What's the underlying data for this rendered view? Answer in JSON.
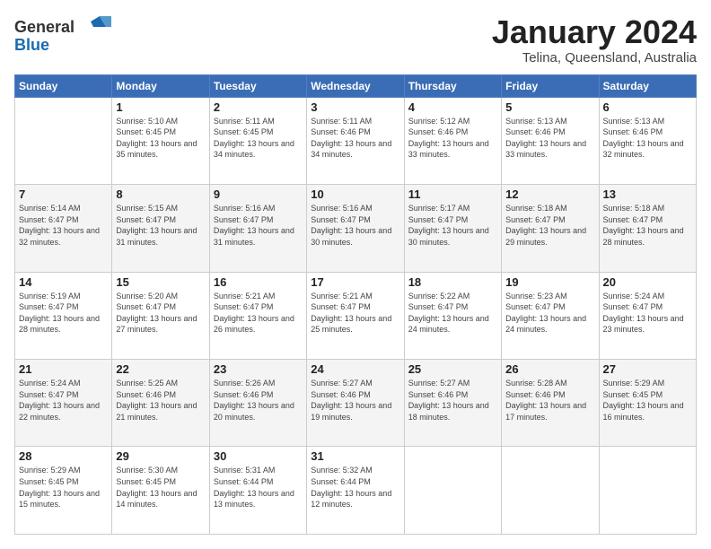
{
  "logo": {
    "general": "General",
    "blue": "Blue"
  },
  "header": {
    "month": "January 2024",
    "location": "Telina, Queensland, Australia"
  },
  "weekdays": [
    "Sunday",
    "Monday",
    "Tuesday",
    "Wednesday",
    "Thursday",
    "Friday",
    "Saturday"
  ],
  "weeks": [
    [
      {
        "day": "",
        "sunrise": "",
        "sunset": "",
        "daylight": ""
      },
      {
        "day": "1",
        "sunrise": "Sunrise: 5:10 AM",
        "sunset": "Sunset: 6:45 PM",
        "daylight": "Daylight: 13 hours and 35 minutes."
      },
      {
        "day": "2",
        "sunrise": "Sunrise: 5:11 AM",
        "sunset": "Sunset: 6:45 PM",
        "daylight": "Daylight: 13 hours and 34 minutes."
      },
      {
        "day": "3",
        "sunrise": "Sunrise: 5:11 AM",
        "sunset": "Sunset: 6:46 PM",
        "daylight": "Daylight: 13 hours and 34 minutes."
      },
      {
        "day": "4",
        "sunrise": "Sunrise: 5:12 AM",
        "sunset": "Sunset: 6:46 PM",
        "daylight": "Daylight: 13 hours and 33 minutes."
      },
      {
        "day": "5",
        "sunrise": "Sunrise: 5:13 AM",
        "sunset": "Sunset: 6:46 PM",
        "daylight": "Daylight: 13 hours and 33 minutes."
      },
      {
        "day": "6",
        "sunrise": "Sunrise: 5:13 AM",
        "sunset": "Sunset: 6:46 PM",
        "daylight": "Daylight: 13 hours and 32 minutes."
      }
    ],
    [
      {
        "day": "7",
        "sunrise": "Sunrise: 5:14 AM",
        "sunset": "Sunset: 6:47 PM",
        "daylight": "Daylight: 13 hours and 32 minutes."
      },
      {
        "day": "8",
        "sunrise": "Sunrise: 5:15 AM",
        "sunset": "Sunset: 6:47 PM",
        "daylight": "Daylight: 13 hours and 31 minutes."
      },
      {
        "day": "9",
        "sunrise": "Sunrise: 5:16 AM",
        "sunset": "Sunset: 6:47 PM",
        "daylight": "Daylight: 13 hours and 31 minutes."
      },
      {
        "day": "10",
        "sunrise": "Sunrise: 5:16 AM",
        "sunset": "Sunset: 6:47 PM",
        "daylight": "Daylight: 13 hours and 30 minutes."
      },
      {
        "day": "11",
        "sunrise": "Sunrise: 5:17 AM",
        "sunset": "Sunset: 6:47 PM",
        "daylight": "Daylight: 13 hours and 30 minutes."
      },
      {
        "day": "12",
        "sunrise": "Sunrise: 5:18 AM",
        "sunset": "Sunset: 6:47 PM",
        "daylight": "Daylight: 13 hours and 29 minutes."
      },
      {
        "day": "13",
        "sunrise": "Sunrise: 5:18 AM",
        "sunset": "Sunset: 6:47 PM",
        "daylight": "Daylight: 13 hours and 28 minutes."
      }
    ],
    [
      {
        "day": "14",
        "sunrise": "Sunrise: 5:19 AM",
        "sunset": "Sunset: 6:47 PM",
        "daylight": "Daylight: 13 hours and 28 minutes."
      },
      {
        "day": "15",
        "sunrise": "Sunrise: 5:20 AM",
        "sunset": "Sunset: 6:47 PM",
        "daylight": "Daylight: 13 hours and 27 minutes."
      },
      {
        "day": "16",
        "sunrise": "Sunrise: 5:21 AM",
        "sunset": "Sunset: 6:47 PM",
        "daylight": "Daylight: 13 hours and 26 minutes."
      },
      {
        "day": "17",
        "sunrise": "Sunrise: 5:21 AM",
        "sunset": "Sunset: 6:47 PM",
        "daylight": "Daylight: 13 hours and 25 minutes."
      },
      {
        "day": "18",
        "sunrise": "Sunrise: 5:22 AM",
        "sunset": "Sunset: 6:47 PM",
        "daylight": "Daylight: 13 hours and 24 minutes."
      },
      {
        "day": "19",
        "sunrise": "Sunrise: 5:23 AM",
        "sunset": "Sunset: 6:47 PM",
        "daylight": "Daylight: 13 hours and 24 minutes."
      },
      {
        "day": "20",
        "sunrise": "Sunrise: 5:24 AM",
        "sunset": "Sunset: 6:47 PM",
        "daylight": "Daylight: 13 hours and 23 minutes."
      }
    ],
    [
      {
        "day": "21",
        "sunrise": "Sunrise: 5:24 AM",
        "sunset": "Sunset: 6:47 PM",
        "daylight": "Daylight: 13 hours and 22 minutes."
      },
      {
        "day": "22",
        "sunrise": "Sunrise: 5:25 AM",
        "sunset": "Sunset: 6:46 PM",
        "daylight": "Daylight: 13 hours and 21 minutes."
      },
      {
        "day": "23",
        "sunrise": "Sunrise: 5:26 AM",
        "sunset": "Sunset: 6:46 PM",
        "daylight": "Daylight: 13 hours and 20 minutes."
      },
      {
        "day": "24",
        "sunrise": "Sunrise: 5:27 AM",
        "sunset": "Sunset: 6:46 PM",
        "daylight": "Daylight: 13 hours and 19 minutes."
      },
      {
        "day": "25",
        "sunrise": "Sunrise: 5:27 AM",
        "sunset": "Sunset: 6:46 PM",
        "daylight": "Daylight: 13 hours and 18 minutes."
      },
      {
        "day": "26",
        "sunrise": "Sunrise: 5:28 AM",
        "sunset": "Sunset: 6:46 PM",
        "daylight": "Daylight: 13 hours and 17 minutes."
      },
      {
        "day": "27",
        "sunrise": "Sunrise: 5:29 AM",
        "sunset": "Sunset: 6:45 PM",
        "daylight": "Daylight: 13 hours and 16 minutes."
      }
    ],
    [
      {
        "day": "28",
        "sunrise": "Sunrise: 5:29 AM",
        "sunset": "Sunset: 6:45 PM",
        "daylight": "Daylight: 13 hours and 15 minutes."
      },
      {
        "day": "29",
        "sunrise": "Sunrise: 5:30 AM",
        "sunset": "Sunset: 6:45 PM",
        "daylight": "Daylight: 13 hours and 14 minutes."
      },
      {
        "day": "30",
        "sunrise": "Sunrise: 5:31 AM",
        "sunset": "Sunset: 6:44 PM",
        "daylight": "Daylight: 13 hours and 13 minutes."
      },
      {
        "day": "31",
        "sunrise": "Sunrise: 5:32 AM",
        "sunset": "Sunset: 6:44 PM",
        "daylight": "Daylight: 13 hours and 12 minutes."
      },
      {
        "day": "",
        "sunrise": "",
        "sunset": "",
        "daylight": ""
      },
      {
        "day": "",
        "sunrise": "",
        "sunset": "",
        "daylight": ""
      },
      {
        "day": "",
        "sunrise": "",
        "sunset": "",
        "daylight": ""
      }
    ]
  ]
}
